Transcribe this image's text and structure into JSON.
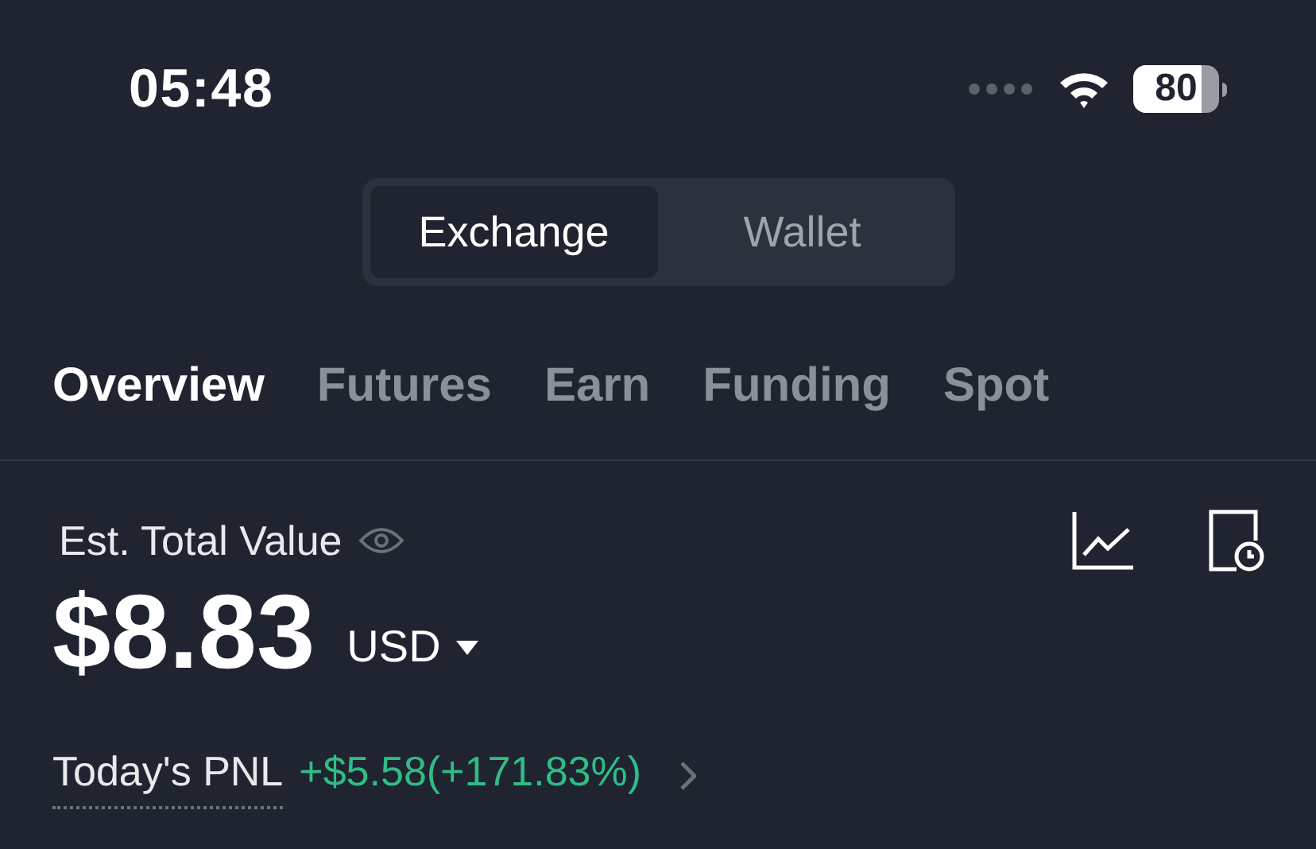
{
  "status_bar": {
    "time": "05:48",
    "battery": "80"
  },
  "segments": [
    {
      "label": "Exchange",
      "selected": true
    },
    {
      "label": "Wallet",
      "selected": false
    }
  ],
  "tabs": [
    {
      "label": "Overview",
      "selected": true
    },
    {
      "label": "Futures",
      "selected": false
    },
    {
      "label": "Earn",
      "selected": false
    },
    {
      "label": "Funding",
      "selected": false
    },
    {
      "label": "Spot",
      "selected": false
    }
  ],
  "balance": {
    "label": "Est. Total Value",
    "amount": "$8.83",
    "currency": "USD",
    "pnl_label": "Today's PNL",
    "pnl_value": "+$5.58(+171.83%)"
  }
}
